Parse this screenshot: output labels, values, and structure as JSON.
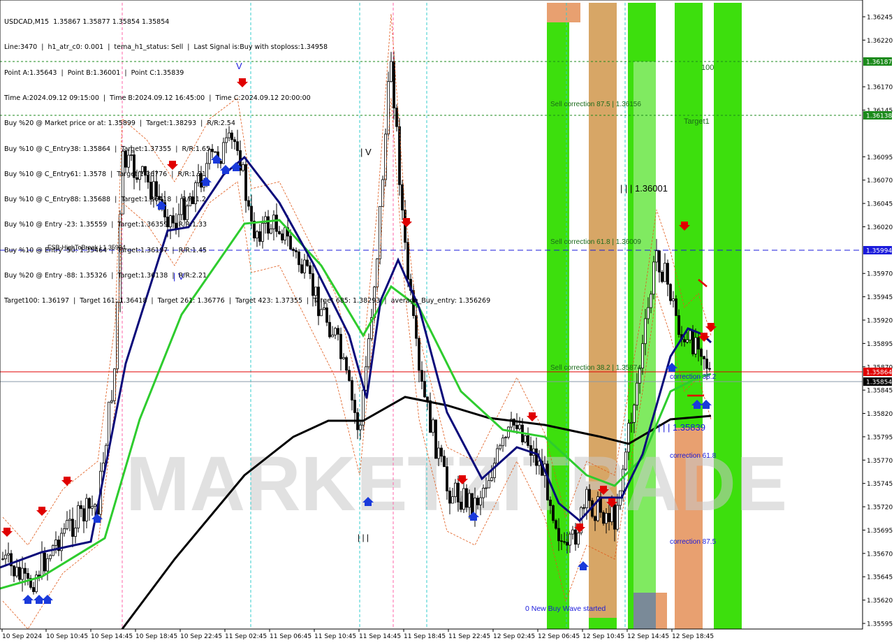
{
  "header": {
    "lines": [
      "USDCAD,M15  1.35867 1.35877 1.35854 1.35854",
      "Line:3470  |  h1_atr_c0: 0.001  |  tema_h1_status: Sell  |  Last Signal is:Buy with stoploss:1.34958",
      "Point A:1.35643  |  Point B:1.36001  |  Point C:1.35839",
      "Time A:2024.09.12 09:15:00  |  Time B:2024.09.12 16:45:00  |  Time C:2024.09.12 20:00:00",
      "Buy %20 @ Market price or at: 1.35899  |  Target:1.38293  |  R/R:2.54",
      "Buy %10 @ C_Entry38: 1.35864  |  Target:1.37355  |  R/R:1.65",
      "Buy %10 @ C_Entry61: 1.3578  |  Target:1.36776  |  R/R:1.21",
      "Buy %10 @ C_Entry88: 1.35688  |  Target:1.36418  |  R/R:1.2",
      "Buy %10 @ Entry -23: 1.35559  |  Target:1.36359  |  R/R:1.33",
      "Buy %10 @ Entry -50: 1.35464  |  Target:1.36197  |  R/R:1.45",
      "Buy %20 @ Entry -88: 1.35326  |  Target:1.36138  |  R/R:2.21",
      "Target100: 1.36197  |  Target 161: 1.36418  |  Target 261: 1.36776  |  Target 423: 1.37355  |  Target 685: 1.38293  |  average_Buy_entry: 1.356269"
    ]
  },
  "chart_data": {
    "type": "candlestick",
    "symbol": "USDCAD",
    "timeframe": "M15",
    "ylim": [
      1.35585,
      1.36265
    ],
    "y_ticks": [
      "1.36245",
      "1.36220",
      "1.36170",
      "1.36145",
      "1.36095",
      "1.36070",
      "1.36045",
      "1.36020",
      "1.35970",
      "1.35945",
      "1.35920",
      "1.35895",
      "1.35870",
      "1.35845",
      "1.35820",
      "1.35795",
      "1.35770",
      "1.35745",
      "1.35720",
      "1.35695",
      "1.35670",
      "1.35645",
      "1.35620",
      "1.35595"
    ],
    "x_ticks": [
      "10 Sep 2024",
      "10 Sep 10:45",
      "10 Sep 14:45",
      "10 Sep 18:45",
      "10 Sep 22:45",
      "11 Sep 02:45",
      "11 Sep 06:45",
      "11 Sep 10:45",
      "11 Sep 14:45",
      "11 Sep 18:45",
      "11 Sep 22:45",
      "12 Sep 02:45",
      "12 Sep 06:45",
      "12 Sep 10:45",
      "12 Sep 14:45",
      "12 Sep 18:45"
    ],
    "price_tags": [
      {
        "label": "1.36187",
        "color": "#1b8a1b"
      },
      {
        "label": "1.36138",
        "color": "#1b8a1b"
      },
      {
        "label": "1.35994",
        "color": "#1a1adb"
      },
      {
        "label": "1.35864",
        "color": "#e00000"
      },
      {
        "label": "1.35854",
        "color": "#000000"
      }
    ],
    "annotations": [
      "100",
      "Target1",
      "Sell correction 87.5 | 1.36156",
      "Sell correction 61.8 | 1.36009",
      "Sell correction 38.2 | 1.35874",
      "correction 38.2",
      "correction 61.8",
      "correction 87.5",
      "| | | 1.36001",
      "| | | 1.35839",
      "FSB-HighToBreak  |  1.35994",
      "0 New Buy Wave started",
      "| V",
      "| V",
      "| | |",
      "V"
    ],
    "watermark": "MARKETZITRADE",
    "colors": {
      "green_zone": "#33dd00",
      "orange_zone": "#e8a070",
      "gray_zone": "#7a8a98",
      "ma_fast": "#0a0a7a",
      "ma_mid": "#2ecc2e",
      "ma_slow": "#000000",
      "buy_arrow": "#1a3adb",
      "sell_arrow": "#e00000",
      "level_green": "#1b8a1b",
      "level_blue": "#1a1adb",
      "level_red": "#e00000",
      "vline_cyan": "#33cccc",
      "vline_pink": "#ff66aa"
    }
  }
}
